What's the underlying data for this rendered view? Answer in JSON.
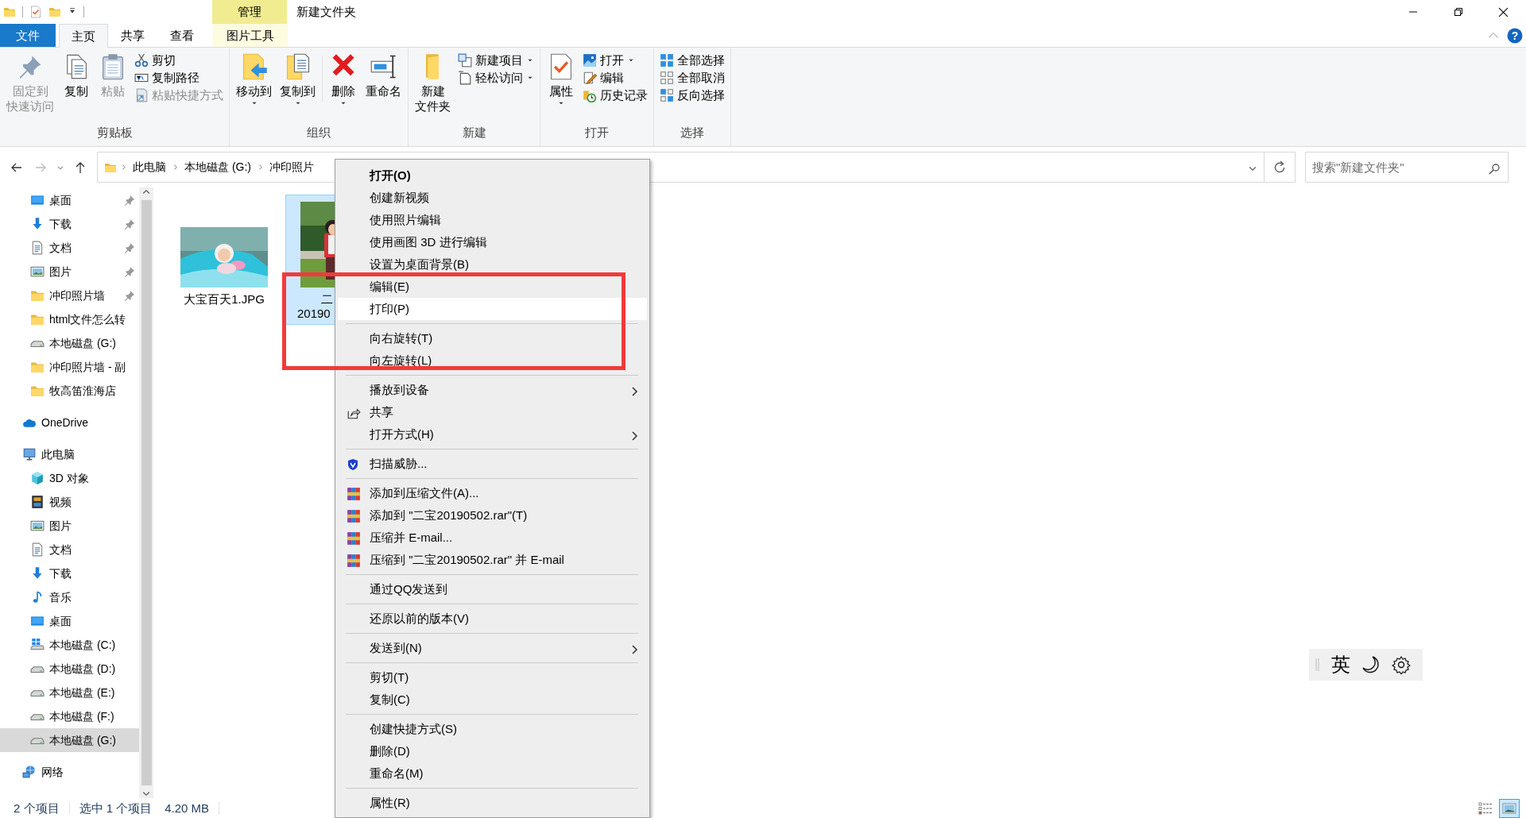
{
  "window": {
    "title": "新建文件夹",
    "context_label": "管理",
    "help_label": "?"
  },
  "ribbon_tabs": [
    {
      "label": "文件",
      "kind": "file",
      "selected": false
    },
    {
      "label": "主页",
      "kind": "tab",
      "selected": true
    },
    {
      "label": "共享",
      "kind": "tab",
      "selected": false
    },
    {
      "label": "查看",
      "kind": "tab",
      "selected": false
    },
    {
      "label": "图片工具",
      "kind": "context",
      "selected": false
    }
  ],
  "ribbon_groups": [
    {
      "label": "剪贴板",
      "large": [
        {
          "label_lines": [
            "固定到",
            "快速访问"
          ],
          "kind": "pin",
          "disabled": true,
          "dropdown": false
        },
        {
          "label": "复制",
          "kind": "copy",
          "disabled": false,
          "dropdown": false
        },
        {
          "label": "粘贴",
          "kind": "paste",
          "disabled": true,
          "dropdown": false
        }
      ],
      "small": [
        {
          "label": "剪切",
          "kind": "cut",
          "disabled": false,
          "dropdown": false
        },
        {
          "label": "复制路径",
          "kind": "path",
          "disabled": false,
          "dropdown": false
        },
        {
          "label": "粘贴快捷方式",
          "kind": "shortcut",
          "disabled": true,
          "dropdown": false
        }
      ]
    },
    {
      "label": "组织",
      "large": [
        {
          "label": "移动到",
          "kind": "move",
          "disabled": false,
          "dropdown": true
        },
        {
          "label": "复制到",
          "kind": "copyto",
          "disabled": false,
          "dropdown": true
        },
        {
          "label": "删除",
          "kind": "delete",
          "disabled": false,
          "dropdown": true
        },
        {
          "label": "重命名",
          "kind": "rename",
          "disabled": false,
          "dropdown": false
        }
      ]
    },
    {
      "label": "新建",
      "large": [
        {
          "label_lines": [
            "新建",
            "文件夹"
          ],
          "kind": "folder",
          "disabled": false,
          "dropdown": false
        }
      ],
      "small": [
        {
          "label": "新建项目",
          "kind": "newitem",
          "disabled": false,
          "dropdown": true
        },
        {
          "label": "轻松访问",
          "kind": "easy",
          "disabled": false,
          "dropdown": true
        }
      ]
    },
    {
      "label": "打开",
      "large": [
        {
          "label": "属性",
          "kind": "properties",
          "disabled": false,
          "dropdown": true
        }
      ],
      "small": [
        {
          "label": "打开",
          "kind": "open",
          "disabled": false,
          "dropdown": true
        },
        {
          "label": "编辑",
          "kind": "edit",
          "disabled": false,
          "dropdown": false
        },
        {
          "label": "历史记录",
          "kind": "history",
          "disabled": false,
          "dropdown": false
        }
      ]
    },
    {
      "label": "选择",
      "small": [
        {
          "label": "全部选择",
          "kind": "selectall",
          "disabled": false,
          "dropdown": false
        },
        {
          "label": "全部取消",
          "kind": "selectnone",
          "disabled": false,
          "dropdown": false
        },
        {
          "label": "反向选择",
          "kind": "invert",
          "disabled": false,
          "dropdown": false
        }
      ]
    }
  ],
  "address": {
    "crumbs": [
      "此电脑",
      "本地磁盘 (G:)",
      "冲印照片"
    ]
  },
  "search": {
    "placeholder": "搜索\"新建文件夹\""
  },
  "nav": {
    "quick_access_items": [
      {
        "label": "桌面",
        "kind": "desktop",
        "pinned": true,
        "selected": false
      },
      {
        "label": "下载",
        "kind": "download",
        "pinned": true,
        "selected": false
      },
      {
        "label": "文档",
        "kind": "document",
        "pinned": true,
        "selected": false
      },
      {
        "label": "图片",
        "kind": "pictures",
        "pinned": true,
        "selected": false
      },
      {
        "label": "冲印照片墙",
        "kind": "folder",
        "pinned": true,
        "selected": false
      },
      {
        "label": "html文件怎么转",
        "kind": "folder",
        "pinned": false,
        "selected": false
      },
      {
        "label": "本地磁盘 (G:)",
        "kind": "drive",
        "pinned": false,
        "selected": false
      },
      {
        "label": "冲印照片墙 - 副",
        "kind": "folder",
        "pinned": false,
        "selected": false
      },
      {
        "label": "牧高笛淮海店",
        "kind": "folder",
        "pinned": false,
        "selected": false
      }
    ],
    "roots": [
      {
        "label": "OneDrive",
        "kind": "cloud",
        "selected": false
      },
      {
        "label": "此电脑",
        "kind": "pc",
        "selected": false,
        "children": [
          {
            "label": "3D 对象",
            "kind": "cube",
            "selected": false
          },
          {
            "label": "视频",
            "kind": "video",
            "selected": false
          },
          {
            "label": "图片",
            "kind": "pictures",
            "selected": false
          },
          {
            "label": "文档",
            "kind": "document",
            "selected": false
          },
          {
            "label": "下载",
            "kind": "download",
            "selected": false
          },
          {
            "label": "音乐",
            "kind": "music",
            "selected": false
          },
          {
            "label": "桌面",
            "kind": "desktop",
            "selected": false
          },
          {
            "label": "本地磁盘 (C:)",
            "kind": "windrive",
            "selected": false
          },
          {
            "label": "本地磁盘 (D:)",
            "kind": "drive",
            "selected": false
          },
          {
            "label": "本地磁盘 (E:)",
            "kind": "drive",
            "selected": false
          },
          {
            "label": "本地磁盘 (F:)",
            "kind": "drive",
            "selected": false
          },
          {
            "label": "本地磁盘 (G:)",
            "kind": "drive",
            "selected": true
          }
        ]
      },
      {
        "label": "网络",
        "kind": "network",
        "selected": false
      }
    ]
  },
  "files": [
    {
      "name_lines": [
        "大宝百天1.JPG"
      ],
      "selected": false
    },
    {
      "name_lines": [
        "二",
        "20190"
      ],
      "selected": true
    }
  ],
  "context_menu": {
    "groups": [
      {
        "items": [
          {
            "label": "打开(O)",
            "kind": "default",
            "selected": false
          },
          {
            "label": "创建新视频",
            "kind": "command",
            "selected": false
          },
          {
            "label": "使用照片编辑",
            "kind": "command",
            "selected": false
          },
          {
            "label": "使用画图 3D 进行编辑",
            "kind": "command",
            "selected": false
          },
          {
            "label": "设置为桌面背景(B)",
            "kind": "command",
            "selected": false
          },
          {
            "label": "编辑(E)",
            "kind": "command",
            "selected": false
          },
          {
            "label": "打印(P)",
            "kind": "command",
            "selected": true
          }
        ]
      },
      {
        "items": [
          {
            "label": "向右旋转(T)",
            "kind": "command",
            "selected": false
          },
          {
            "label": "向左旋转(L)",
            "kind": "command",
            "selected": false
          }
        ]
      },
      {
        "items": [
          {
            "label": "播放到设备",
            "kind": "submenu",
            "selected": false
          },
          {
            "label": "共享",
            "kind": "share",
            "selected": false
          },
          {
            "label": "打开方式(H)",
            "kind": "submenu",
            "selected": false
          }
        ]
      },
      {
        "items": [
          {
            "label": "扫描威胁...",
            "kind": "scan",
            "selected": false
          }
        ]
      },
      {
        "items": [
          {
            "label": "添加到压缩文件(A)...",
            "kind": "archive",
            "selected": false
          },
          {
            "label": "添加到 \"二宝20190502.rar\"(T)",
            "kind": "archive",
            "selected": false
          },
          {
            "label": "压缩并 E-mail...",
            "kind": "archive",
            "selected": false
          },
          {
            "label": "压缩到 \"二宝20190502.rar\" 并 E-mail",
            "kind": "archive",
            "selected": false
          }
        ]
      },
      {
        "items": [
          {
            "label": "通过QQ发送到",
            "kind": "command",
            "selected": false
          }
        ]
      },
      {
        "items": [
          {
            "label": "还原以前的版本(V)",
            "kind": "command",
            "selected": false
          }
        ]
      },
      {
        "items": [
          {
            "label": "发送到(N)",
            "kind": "submenu",
            "selected": false
          }
        ]
      },
      {
        "items": [
          {
            "label": "剪切(T)",
            "kind": "command",
            "selected": false
          },
          {
            "label": "复制(C)",
            "kind": "command",
            "selected": false
          }
        ]
      },
      {
        "items": [
          {
            "label": "创建快捷方式(S)",
            "kind": "command",
            "selected": false
          },
          {
            "label": "删除(D)",
            "kind": "command",
            "selected": false
          },
          {
            "label": "重命名(M)",
            "kind": "command",
            "selected": false
          }
        ]
      },
      {
        "items": [
          {
            "label": "属性(R)",
            "kind": "command",
            "selected": false
          }
        ]
      }
    ]
  },
  "status_bar": {
    "item_count": "2 个项目",
    "selection": "选中 1 个项目",
    "size": "4.20 MB"
  },
  "view_buttons": [
    {
      "kind": "details",
      "selected": false
    },
    {
      "kind": "large-icons",
      "selected": true
    }
  ],
  "ime_bar": {
    "mode": "英"
  }
}
